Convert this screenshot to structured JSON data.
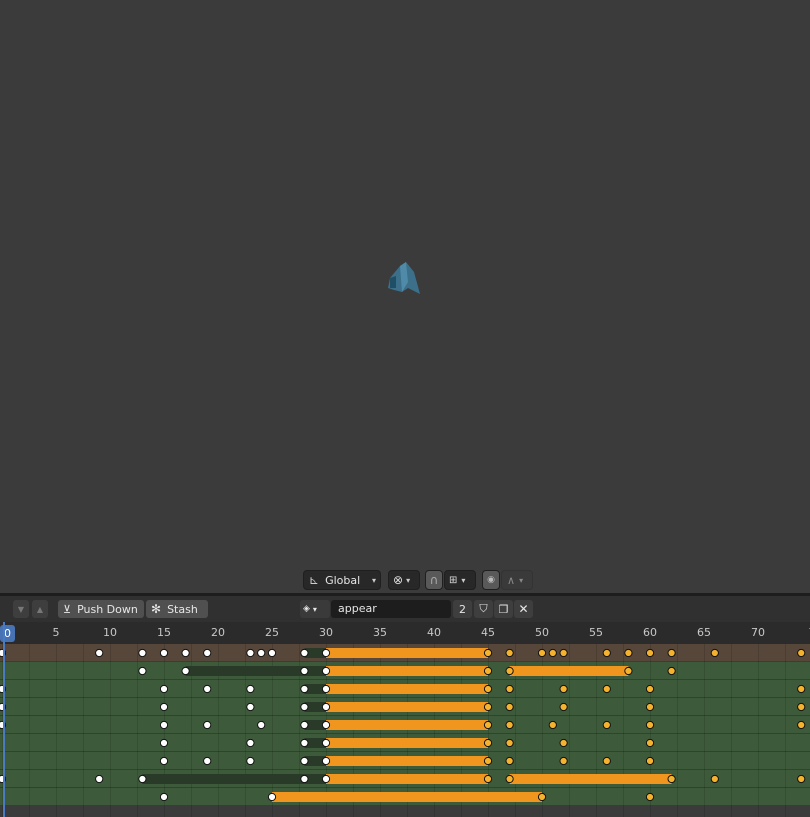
{
  "viewport": {
    "toolbar": {
      "transform_orientation": "Global",
      "pivot_icon": "linked-pivot-icon",
      "snap_icon": "magnet-icon",
      "snap_target_icon": "snap-increment-icon",
      "proportional_icon": "proportional-edit-icon",
      "falloff_icon": "falloff-curve-icon"
    },
    "object_color": "#3b6f8a"
  },
  "dopesheet": {
    "header": {
      "push_down_label": "Push Down",
      "stash_label": "Stash",
      "action_name": "appear",
      "user_count": "2"
    },
    "ruler": {
      "current_frame": "0",
      "tick_labels": [
        "5",
        "10",
        "15",
        "20",
        "25",
        "30",
        "35",
        "40",
        "45",
        "50",
        "55",
        "60",
        "65",
        "70",
        "7"
      ]
    },
    "colors": {
      "summary_row": "#57463a",
      "channel_row": "#3d5b3b",
      "hold_bar": "#f0961e",
      "static_bar": "#2a3a28",
      "selected_key": "#f4b22e",
      "unselected_key": "#ffffff",
      "playhead": "#4a7bc2"
    },
    "channels": [
      {
        "type": "summary",
        "keys": [
          0,
          9,
          13,
          15,
          17,
          19,
          23,
          24,
          25,
          28,
          30,
          45,
          47,
          50,
          51,
          52,
          56,
          58,
          60,
          62,
          66,
          74
        ],
        "selected_from": 45,
        "holds": [
          {
            "from": 28,
            "to": 30,
            "kind": "static"
          },
          {
            "from": 30,
            "to": 45,
            "kind": "hold"
          }
        ]
      },
      {
        "type": "channel",
        "keys": [
          13,
          17,
          28,
          30,
          45,
          47,
          58,
          62
        ],
        "selected_from": 45,
        "holds": [
          {
            "from": 17,
            "to": 30,
            "kind": "static"
          },
          {
            "from": 30,
            "to": 45,
            "kind": "hold"
          },
          {
            "from": 47,
            "to": 58,
            "kind": "hold"
          }
        ]
      },
      {
        "type": "channel",
        "keys": [
          0,
          15,
          19,
          23,
          28,
          30,
          45,
          47,
          52,
          56,
          60,
          74
        ],
        "selected_from": 45,
        "holds": [
          {
            "from": 28,
            "to": 30,
            "kind": "static"
          },
          {
            "from": 30,
            "to": 45,
            "kind": "hold"
          }
        ]
      },
      {
        "type": "channel",
        "keys": [
          0,
          15,
          23,
          28,
          30,
          45,
          47,
          52,
          60,
          74
        ],
        "selected_from": 45,
        "holds": [
          {
            "from": 28,
            "to": 30,
            "kind": "static"
          },
          {
            "from": 30,
            "to": 45,
            "kind": "hold"
          }
        ]
      },
      {
        "type": "channel",
        "keys": [
          0,
          15,
          19,
          24,
          28,
          30,
          45,
          47,
          51,
          56,
          60,
          74
        ],
        "selected_from": 45,
        "holds": [
          {
            "from": 28,
            "to": 30,
            "kind": "static"
          },
          {
            "from": 30,
            "to": 45,
            "kind": "hold"
          }
        ]
      },
      {
        "type": "channel",
        "keys": [
          15,
          23,
          28,
          30,
          45,
          47,
          52,
          60
        ],
        "selected_from": 45,
        "holds": [
          {
            "from": 28,
            "to": 30,
            "kind": "static"
          },
          {
            "from": 30,
            "to": 45,
            "kind": "hold"
          }
        ]
      },
      {
        "type": "channel",
        "keys": [
          15,
          19,
          23,
          28,
          30,
          45,
          47,
          52,
          56,
          60
        ],
        "selected_from": 45,
        "holds": [
          {
            "from": 28,
            "to": 30,
            "kind": "static"
          },
          {
            "from": 30,
            "to": 45,
            "kind": "hold"
          }
        ]
      },
      {
        "type": "channel",
        "keys": [
          0,
          9,
          13,
          28,
          30,
          45,
          47,
          62,
          66,
          74
        ],
        "selected_from": 45,
        "holds": [
          {
            "from": 13,
            "to": 30,
            "kind": "static"
          },
          {
            "from": 30,
            "to": 45,
            "kind": "hold"
          },
          {
            "from": 47,
            "to": 62,
            "kind": "hold"
          }
        ]
      },
      {
        "type": "channel",
        "keys": [
          15,
          25,
          50,
          60
        ],
        "selected_from": 50,
        "holds": [
          {
            "from": 25,
            "to": 50,
            "kind": "hold"
          }
        ]
      }
    ]
  }
}
